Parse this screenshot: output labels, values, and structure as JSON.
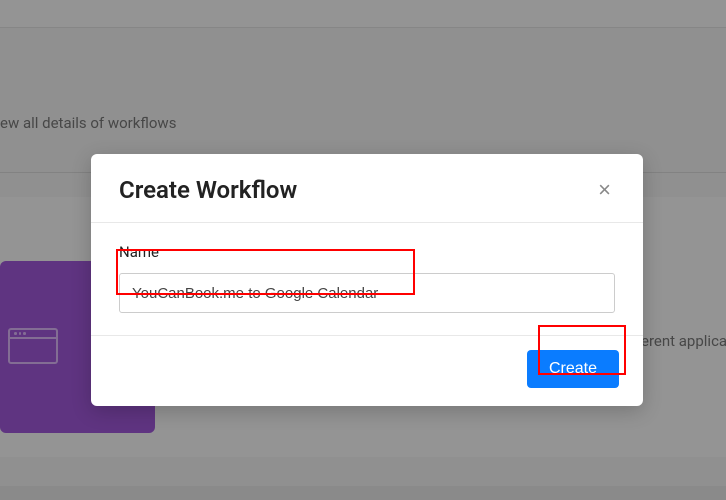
{
  "background": {
    "workflows_text": "ew all details of workflows",
    "right_text": "erent applica"
  },
  "modal": {
    "title": "Create Workflow",
    "close_label": "×",
    "name_label": "Name",
    "name_value": "YouCanBook.me to Google Calendar",
    "create_label": "Create"
  }
}
